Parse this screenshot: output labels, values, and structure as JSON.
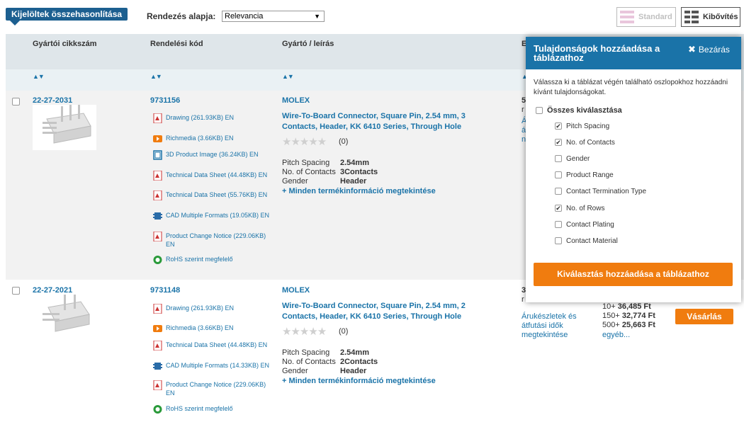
{
  "toolbar": {
    "compare_label": "Kijelöltek összehasonlítása",
    "sort_label": "Rendezés alapja:",
    "sort_value": "Relevancia",
    "standard_label": "Standard",
    "extended_label": "Kibővítés"
  },
  "table": {
    "headers": [
      "Gyártói cikkszám",
      "Rendelési kód",
      "Gyártó / leírás",
      "E"
    ]
  },
  "rows": [
    {
      "part_no": "22-27-2031",
      "order_code": "9731156",
      "manufacturer": "MOLEX",
      "description": "Wire-To-Board Connector, Square Pin, 2.54 mm, 3 Contacts, Header, KK 6410 Series, Through Hole",
      "rating": "(0)",
      "docs": [
        {
          "icon": "pdf-icon",
          "label": "Drawing (261.93KB) EN"
        },
        {
          "icon": "video-icon",
          "label": "Richmedia (3.66KB) EN"
        },
        {
          "icon": "cube-icon",
          "label": "3D Product Image (36.24KB) EN"
        },
        {
          "icon": "pdf-icon",
          "label": "Technical Data Sheet (44.48KB) EN"
        },
        {
          "icon": "pdf-icon",
          "label": "Technical Data Sheet (55.76KB) EN"
        },
        {
          "icon": "cad-icon",
          "label": "CAD Multiple Formats (19.05KB) EN"
        },
        {
          "icon": "pdf-icon",
          "label": "Product Change Notice (229.06KB) EN"
        },
        {
          "icon": "rohs-icon",
          "label": "RoHS szerint megfelelő"
        }
      ],
      "attrs": [
        {
          "name": "Pitch Spacing",
          "value": "2.54mm"
        },
        {
          "name": "No. of Contacts",
          "value": "3Contacts"
        },
        {
          "name": "Gender",
          "value": "Header"
        }
      ],
      "more_label": "+ Minden termékinformáció megtekintése",
      "stock_fragments": [
        "5",
        "r",
        "Á",
        "á",
        "n"
      ]
    },
    {
      "part_no": "22-27-2021",
      "order_code": "9731148",
      "manufacturer": "MOLEX",
      "description": "Wire-To-Board Connector, Square Pin, 2.54 mm, 2 Contacts, Header, KK 6410 Series, Through Hole",
      "rating": "(0)",
      "docs": [
        {
          "icon": "pdf-icon",
          "label": "Drawing (261.93KB) EN"
        },
        {
          "icon": "video-icon",
          "label": "Richmedia (3.66KB) EN"
        },
        {
          "icon": "pdf-icon",
          "label": "Technical Data Sheet (44.48KB) EN"
        },
        {
          "icon": "cad-icon",
          "label": "CAD Multiple Formats (14.33KB) EN"
        },
        {
          "icon": "pdf-icon",
          "label": "Product Change Notice (229.06KB) EN"
        },
        {
          "icon": "rohs-icon",
          "label": "RoHS szerint megfelelő"
        }
      ],
      "attrs": [
        {
          "name": "Pitch Spacing",
          "value": "2.54mm"
        },
        {
          "name": "No. of Contacts",
          "value": "2Contacts"
        },
        {
          "name": "Gender",
          "value": "Header"
        }
      ],
      "more_label": "+ Minden termékinformáció megtekintése",
      "stock_prefix": [
        "3",
        "r"
      ],
      "stock_link": "Árukészletek és átfutási idők megtekintése",
      "prices": [
        {
          "qty": "10+",
          "price": "36,485 Ft"
        },
        {
          "qty": "150+",
          "price": "32,774 Ft"
        },
        {
          "qty": "500+",
          "price": "25,663 Ft"
        }
      ],
      "more_prices": "egyéb...",
      "buy_label": "Vásárlás"
    }
  ],
  "popup": {
    "title": "Tulajdonságok hozzáadása a táblázathoz",
    "close_label": "Bezárás",
    "intro": "Válassza ki a táblázat végén található oszlopokhoz hozzáadni kívánt tulajdonságokat.",
    "select_all": "Összes kiválasztása",
    "options": [
      {
        "label": "Pitch Spacing",
        "checked": true
      },
      {
        "label": "No. of Contacts",
        "checked": true
      },
      {
        "label": "Gender",
        "checked": false
      },
      {
        "label": "Product Range",
        "checked": false
      },
      {
        "label": "Contact Termination Type",
        "checked": false
      },
      {
        "label": "No. of Rows",
        "checked": true
      },
      {
        "label": "Contact Plating",
        "checked": false
      },
      {
        "label": "Contact Material",
        "checked": false
      }
    ],
    "add_label": "Kiválasztás hozzáadása a táblázathoz"
  },
  "colors": {
    "accent_blue": "#1a73a8",
    "button_orange": "#f07c0f",
    "compare_blue": "#1c5f90"
  }
}
